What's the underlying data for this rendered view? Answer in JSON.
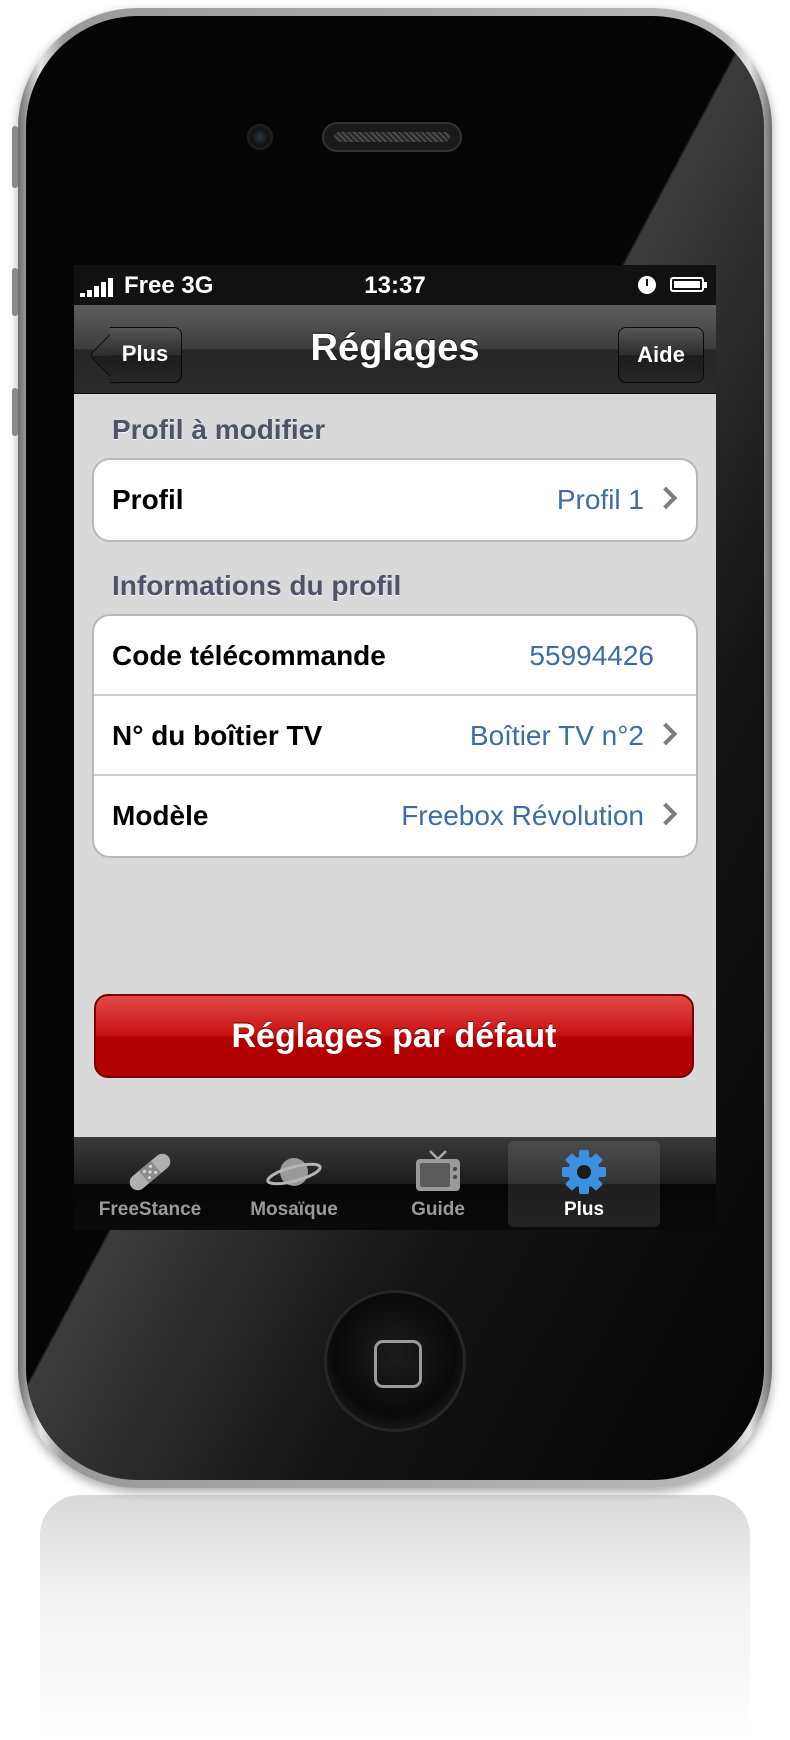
{
  "status_bar": {
    "carrier": "Free 3G",
    "time": "13:37"
  },
  "nav_bar": {
    "title": "Réglages",
    "back_label": "Plus",
    "help_label": "Aide"
  },
  "sections": [
    {
      "header": "Profil à modifier",
      "rows": [
        {
          "label": "Profil",
          "value": "Profil 1"
        }
      ]
    },
    {
      "header": "Informations du profil",
      "rows": [
        {
          "label": "Code télécommande",
          "value": "55994426"
        },
        {
          "label": "N° du boîtier TV",
          "value": "Boîtier TV n°2"
        },
        {
          "label": "Modèle",
          "value": "Freebox Révolution"
        }
      ]
    }
  ],
  "reset_button": "Réglages par défaut",
  "tabs": [
    {
      "label": "FreeStance",
      "icon": "bandage-icon"
    },
    {
      "label": "Mosaïque",
      "icon": "planet-icon"
    },
    {
      "label": "Guide",
      "icon": "tv-icon"
    },
    {
      "label": "Plus",
      "icon": "gear-icon"
    }
  ],
  "colors": {
    "accent_blue": "#3a6ea5",
    "reset_red": "#b00000",
    "active_tab_blue": "#3d8fe0"
  }
}
